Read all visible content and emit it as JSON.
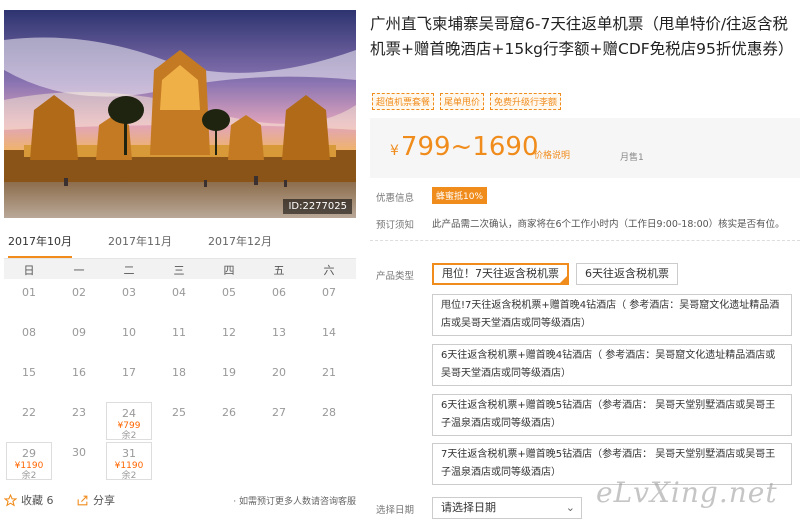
{
  "hero": {
    "id_label": "ID:2277025"
  },
  "months": [
    "2017年10月",
    "2017年11月",
    "2017年12月"
  ],
  "weekdays": [
    "日",
    "一",
    "二",
    "三",
    "四",
    "五",
    "六"
  ],
  "calendar": {
    "days": [
      "01",
      "02",
      "03",
      "04",
      "05",
      "06",
      "07",
      "08",
      "09",
      "10",
      "11",
      "12",
      "13",
      "14",
      "15",
      "16",
      "17",
      "18",
      "19",
      "20",
      "21",
      "22",
      "23",
      "24",
      "25",
      "26",
      "27",
      "28",
      "29",
      "30",
      "31"
    ],
    "available": {
      "24": {
        "price": "¥799",
        "rest": "余2"
      },
      "29": {
        "price": "¥1190",
        "rest": "余2"
      },
      "31": {
        "price": "¥1190",
        "rest": "余2"
      }
    }
  },
  "bottom": {
    "fav": "收藏 6",
    "share": "分享",
    "note": "· 如需预订更多人数请咨询客服"
  },
  "product": {
    "title": "广州直飞柬埔寨吴哥窟6-7天往返单机票（甩单特价/往返含税机票+赠首晚酒店+15kg行李额+赠CDF免税店95折优惠券）",
    "tags": [
      "超值机票套餐",
      "尾单甩价",
      "免费升级行李额"
    ],
    "price": "799~1690",
    "currency": "¥",
    "price_explain": "价格说明",
    "sold": "月售1"
  },
  "promo": {
    "label": "优惠信息",
    "badge": "蜂蜜抵10%"
  },
  "notice": {
    "label": "预订须知",
    "text": "此产品需二次确认，商家将在6个工作小时内（工作日9:00-18:00）核实是否有位。"
  },
  "types": {
    "label": "产品类型",
    "buttons": [
      "甩位！7天往返含税机票",
      "6天往返含税机票"
    ],
    "options": [
      "甩位!7天往返含税机票+赠首晚4钻酒店（ 参考酒店：吴哥窟文化遗址精品酒店或吴哥天堂酒店或同等级酒店）",
      "6天往返含税机票+赠首晚4钻酒店（ 参考酒店：吴哥窟文化遗址精品酒店或吴哥天堂酒店或同等级酒店）",
      "6天往返含税机票+赠首晚5钻酒店（参考酒店： 吴哥天堂别墅酒店或吴哥王子温泉酒店或同等级酒店）",
      "7天往返含税机票+赠首晚5钻酒店（参考酒店： 吴哥天堂别墅酒店或吴哥王子温泉酒店或同等级酒店）"
    ]
  },
  "date": {
    "label": "选择日期",
    "placeholder": "请选择日期"
  },
  "watermark": "eLvXing.net",
  "colors": {
    "accent": "#f08c1c",
    "price": "#f60"
  }
}
